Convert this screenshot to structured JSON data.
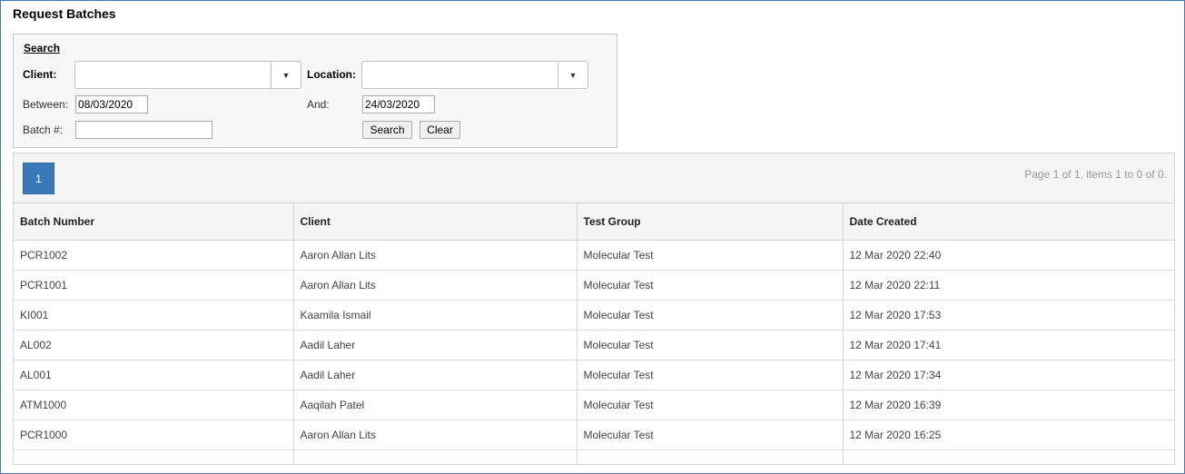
{
  "page": {
    "title": "Request Batches"
  },
  "search": {
    "heading": "Search",
    "client_label": "Client:",
    "client_value": "",
    "location_label": "Location:",
    "location_value": "",
    "between_label": "Between:",
    "between_value": "08/03/2020",
    "and_label": "And:",
    "and_value": "24/03/2020",
    "batch_label": "Batch #:",
    "batch_value": "",
    "search_button": "Search",
    "clear_button": "Clear",
    "dropdown_arrow": "▼"
  },
  "pager": {
    "current_page": "1",
    "info": "Page 1 of 1, items 1 to 0 of 0."
  },
  "table": {
    "columns": [
      "Batch Number",
      "Client",
      "Test Group",
      "Date Created"
    ],
    "rows": [
      [
        "PCR1002",
        "Aaron Allan Lits",
        "Molecular Test",
        "12 Mar 2020 22:40"
      ],
      [
        "PCR1001",
        "Aaron Allan Lits",
        "Molecular Test",
        "12 Mar 2020 22:11"
      ],
      [
        "KI001",
        "Kaamila Ismail",
        "Molecular Test",
        "12 Mar 2020 17:53"
      ],
      [
        "AL002",
        "Aadil Laher",
        "Molecular Test",
        "12 Mar 2020 17:41"
      ],
      [
        "AL001",
        "Aadil Laher",
        "Molecular Test",
        "12 Mar 2020 17:34"
      ],
      [
        "ATM1000",
        "Aaqilah Patel",
        "Molecular Test",
        "12 Mar 2020 16:39"
      ],
      [
        "PCR1000",
        "Aaron Allan Lits",
        "Molecular Test",
        "12 Mar 2020 16:25"
      ]
    ]
  },
  "colors": {
    "accent": "#3a78b9",
    "frame": "#4a78b8"
  }
}
